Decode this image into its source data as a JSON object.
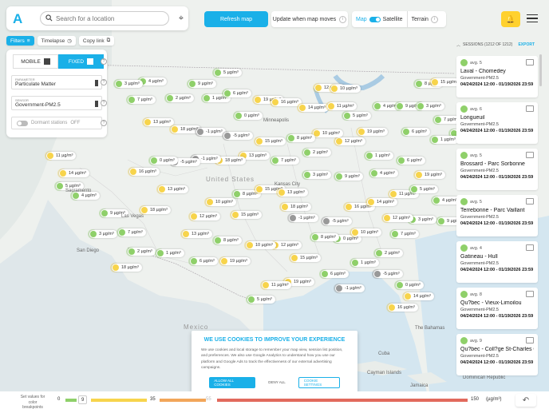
{
  "header": {
    "search_placeholder": "Search for a location",
    "refresh_label": "Refresh map",
    "update_label": "Update when map moves",
    "map_label": "Map",
    "satellite_label": "Satellite",
    "terrain_label": "Terrain"
  },
  "tabs": [
    {
      "label": "Filters",
      "active": true
    },
    {
      "label": "Timelapse",
      "active": false
    },
    {
      "label": "Copy link",
      "active": false
    }
  ],
  "filters": {
    "mobile_label": "MOBILE",
    "fixed_label": "FIXED",
    "parameter_label": "PARAMETER",
    "parameter_value": "Particulate Matter",
    "sensor_label": "SENSOR",
    "sensor_value": "Government-PM2.5",
    "dormant_label": "Dormant stations",
    "dormant_state": "OFF"
  },
  "sessions": {
    "header": "SESSIONS (1212 OF 1212)",
    "export_label": "EXPORT",
    "items": [
      {
        "avg": "avg. 5",
        "name": "Laval - Chomedey",
        "sensor": "Government-PM2.5",
        "dates": "04/24/2024 12:00 - 01/19/2026 23:59"
      },
      {
        "avg": "avg. 6",
        "name": "Longueuil",
        "sensor": "Government-PM2.5",
        "dates": "04/24/2024 12:00 - 01/19/2026 23:59"
      },
      {
        "avg": "avg. 5",
        "name": "Brossard - Parc Sorbonne",
        "sensor": "Government-PM2.5",
        "dates": "04/24/2024 12:00 - 01/19/2026 23:59"
      },
      {
        "avg": "avg. 5",
        "name": "Terrebonne - Parc Vaillant",
        "sensor": "Government-PM2.5",
        "dates": "04/24/2024 12:00 - 01/19/2026 23:59"
      },
      {
        "avg": "avg. 4",
        "name": "Gatineau - Hull",
        "sensor": "Government-PM2.5",
        "dates": "04/24/2024 12:00 - 01/19/2026 23:59"
      },
      {
        "avg": "avg. 8",
        "name": "Qu?bec - Vieux-Limoilou",
        "sensor": "Government-PM2.5",
        "dates": "04/24/2024 12:00 - 01/19/2026 23:59"
      },
      {
        "avg": "avg. 9",
        "name": "Qu?bec - Coll?ge St-Charles G...",
        "sensor": "Government-PM2.5",
        "dates": "04/24/2024 12:00 - 01/19/2026 23:59"
      }
    ]
  },
  "cookie": {
    "title": "WE USE COOKIES TO IMPROVE YOUR EXPERIENCE",
    "body": "We use cookies and local storage to remember your map view, session list position, and preferences. We also use Google Analytics to understand how you use our platform and Google Ads to track the effectiveness of our external advertising campaigns.",
    "allow_label": "ALLOW ALL COOKIES",
    "deny_label": "DENY ALL",
    "settings_label": "COOKIE SETTINGS"
  },
  "legend": {
    "caption": "Set values for color breakpoints",
    "v0": "0",
    "v1": "9",
    "v2": "35",
    "v3": "55",
    "v4": "150",
    "unit": "(µg/m³)"
  },
  "map_labels": {
    "united_states": "United States",
    "mexico": "Mexico",
    "cuba": "Cuba",
    "san_diego": "San Diego",
    "las_vegas": "Las Vegas",
    "kansas_city": "Kansas City",
    "sacramento": "Sacramento",
    "minneapolis": "Minneapolis",
    "bahamas": "The Bahamas",
    "cayman": "Cayman Islands",
    "dominican": "Dominican Republic",
    "jamaica": "Jamaica"
  },
  "markers": [
    {
      "v": "5 µg/m³",
      "c": "#8fd06a"
    },
    {
      "v": "4 µg/m³",
      "c": "#8fd06a"
    },
    {
      "v": "9 µg/m³",
      "c": "#8fd06a"
    },
    {
      "v": "3 µg/m³",
      "c": "#8fd06a"
    },
    {
      "v": "7 µg/m³",
      "c": "#8fd06a"
    },
    {
      "v": "2 µg/m³",
      "c": "#8fd06a"
    },
    {
      "v": "1 µg/m³",
      "c": "#8fd06a"
    },
    {
      "v": "6 µg/m³",
      "c": "#8fd06a"
    },
    {
      "v": "19 µg/m³",
      "c": "#f7d44c"
    },
    {
      "v": "12 µg/m³",
      "c": "#f7d44c"
    },
    {
      "v": "10 µg/m³",
      "c": "#f7d44c"
    },
    {
      "v": "8 µg/m³",
      "c": "#8fd06a"
    },
    {
      "v": "15 µg/m³",
      "c": "#f7d44c"
    },
    {
      "v": "13 µg/m³",
      "c": "#f7d44c"
    },
    {
      "v": "18 µg/m³",
      "c": "#f7d44c"
    },
    {
      "v": "-1 µg/m³",
      "c": "#999"
    },
    {
      "v": "-5 µg/m³",
      "c": "#999"
    },
    {
      "v": "0 µg/m³",
      "c": "#8fd06a"
    },
    {
      "v": "16 µg/m³",
      "c": "#f7d44c"
    },
    {
      "v": "14 µg/m³",
      "c": "#f7d44c"
    },
    {
      "v": "11 µg/m³",
      "c": "#f7d44c"
    }
  ],
  "colors": {
    "accent": "#1ab0e8",
    "green": "#8fd06a",
    "yellow": "#f7d44c",
    "orange": "#f2a65a",
    "red": "#e26a5d",
    "bell": "#ffd12e"
  }
}
